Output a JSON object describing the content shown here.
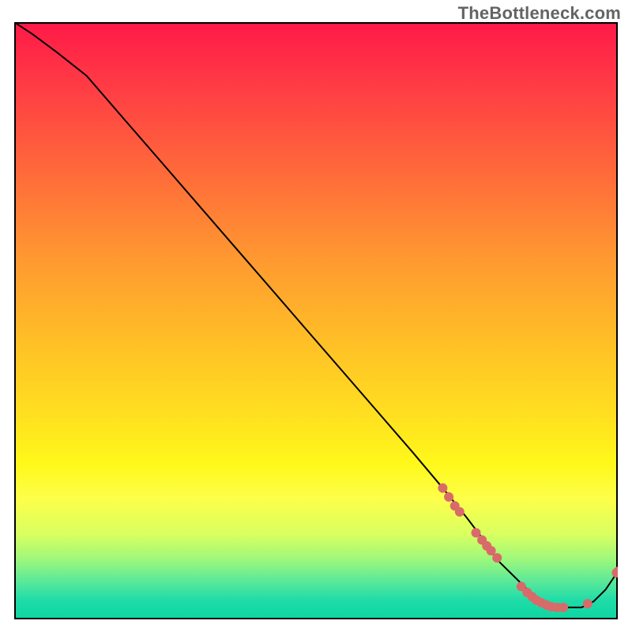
{
  "watermark": "TheBottleneck.com",
  "colors": {
    "curve": "#000000",
    "marker": "#d96a6a",
    "gradient_top": "#ff1a48",
    "gradient_bottom": "#0fd6a2"
  },
  "chart_data": {
    "type": "line",
    "title": "",
    "xlabel": "",
    "ylabel": "",
    "xlim": [
      0,
      100
    ],
    "ylim": [
      0,
      100
    ],
    "grid": false,
    "legend": false,
    "axes_visible": false,
    "series": [
      {
        "name": "curve",
        "x": [
          0,
          3,
          7,
          12,
          18,
          24,
          30,
          36,
          42,
          48,
          54,
          60,
          66,
          71,
          75,
          78,
          80,
          82,
          84,
          86,
          88,
          90,
          92,
          94,
          96,
          98,
          100
        ],
        "y": [
          100,
          98,
          95,
          91,
          84,
          77,
          70,
          63,
          56,
          49,
          42,
          35,
          28,
          22,
          17,
          13,
          10,
          8,
          6,
          4,
          3,
          2,
          2,
          2,
          3,
          5,
          8
        ]
      }
    ],
    "markers": {
      "name": "dense-points",
      "note": "clustered points along the curve near its minimum",
      "points": [
        {
          "x": 71.0,
          "y": 22.0
        },
        {
          "x": 72.0,
          "y": 20.5
        },
        {
          "x": 73.0,
          "y": 19.0
        },
        {
          "x": 73.8,
          "y": 18.0
        },
        {
          "x": 76.5,
          "y": 14.5
        },
        {
          "x": 77.5,
          "y": 13.3
        },
        {
          "x": 78.3,
          "y": 12.3
        },
        {
          "x": 79.0,
          "y": 11.5
        },
        {
          "x": 80.0,
          "y": 10.3
        },
        {
          "x": 84.0,
          "y": 5.5
        },
        {
          "x": 85.0,
          "y": 4.5
        },
        {
          "x": 85.8,
          "y": 3.8
        },
        {
          "x": 86.5,
          "y": 3.2
        },
        {
          "x": 87.3,
          "y": 2.8
        },
        {
          "x": 88.2,
          "y": 2.4
        },
        {
          "x": 89.0,
          "y": 2.1
        },
        {
          "x": 90.0,
          "y": 2.0
        },
        {
          "x": 91.0,
          "y": 2.0
        },
        {
          "x": 95.0,
          "y": 2.6
        },
        {
          "x": 99.8,
          "y": 7.8
        },
        {
          "x": 100.0,
          "y": 8.0
        }
      ]
    }
  }
}
